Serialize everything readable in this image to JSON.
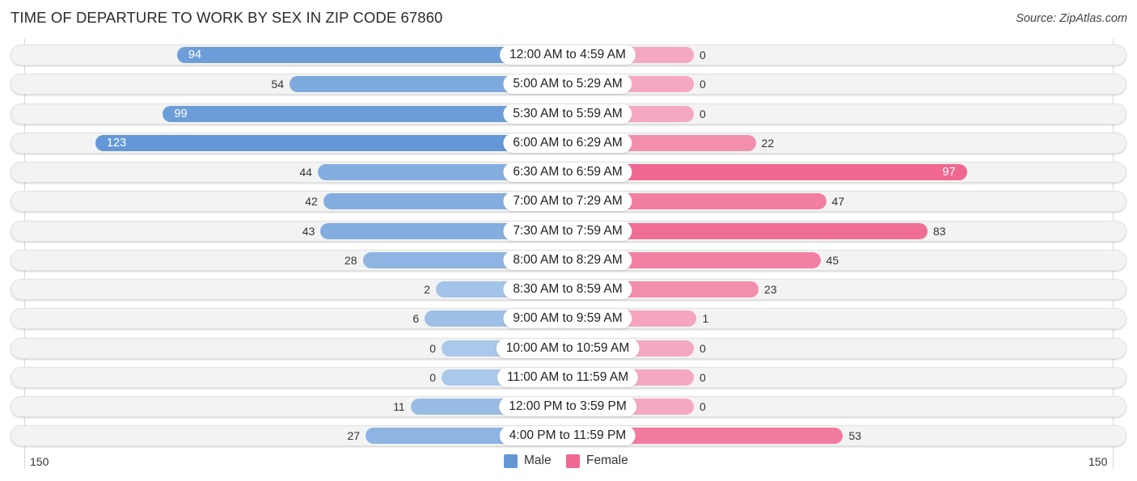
{
  "title": "TIME OF DEPARTURE TO WORK BY SEX IN ZIP CODE 67860",
  "source": "Source: ZipAtlas.com",
  "colors": {
    "male_dark": "#6497d6",
    "male_light": "#a9c8ea",
    "female_dark": "#f06890",
    "female_light": "#f5a9c0",
    "row_bg": "#f3f3f3"
  },
  "chart_data": {
    "type": "bar",
    "orientation": "horizontal-diverging",
    "title": "TIME OF DEPARTURE TO WORK BY SEX IN ZIP CODE 67860",
    "categories": [
      "12:00 AM to 4:59 AM",
      "5:00 AM to 5:29 AM",
      "5:30 AM to 5:59 AM",
      "6:00 AM to 6:29 AM",
      "6:30 AM to 6:59 AM",
      "7:00 AM to 7:29 AM",
      "7:30 AM to 7:59 AM",
      "8:00 AM to 8:29 AM",
      "8:30 AM to 8:59 AM",
      "9:00 AM to 9:59 AM",
      "10:00 AM to 10:59 AM",
      "11:00 AM to 11:59 AM",
      "12:00 PM to 3:59 PM",
      "4:00 PM to 11:59 PM"
    ],
    "series": [
      {
        "name": "Male",
        "values": [
          94,
          54,
          99,
          123,
          44,
          42,
          43,
          28,
          2,
          6,
          0,
          0,
          11,
          27
        ]
      },
      {
        "name": "Female",
        "values": [
          0,
          0,
          0,
          22,
          97,
          47,
          83,
          45,
          23,
          1,
          0,
          0,
          0,
          53
        ]
      }
    ],
    "axis": {
      "left_label": "150",
      "right_label": "150",
      "range": [
        0,
        150
      ]
    },
    "legend": {
      "position": "bottom-center",
      "entries": [
        "Male",
        "Female"
      ]
    },
    "xlabel": "",
    "ylabel": ""
  }
}
